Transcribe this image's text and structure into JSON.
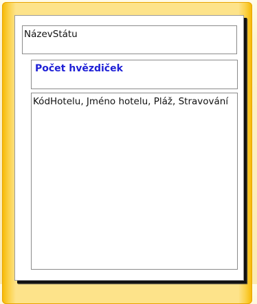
{
  "report": {
    "state_field": "NázevStátu",
    "stars_field": "Počet hvězdiček",
    "hotel_fields": "KódHotelu, Jméno hotelu, Pláž, Stravování"
  },
  "colors": {
    "frame": "#fbd24a",
    "frame_edge": "#f6b800",
    "stars_text": "#1d1fd6",
    "card_shadow": "#111111"
  }
}
